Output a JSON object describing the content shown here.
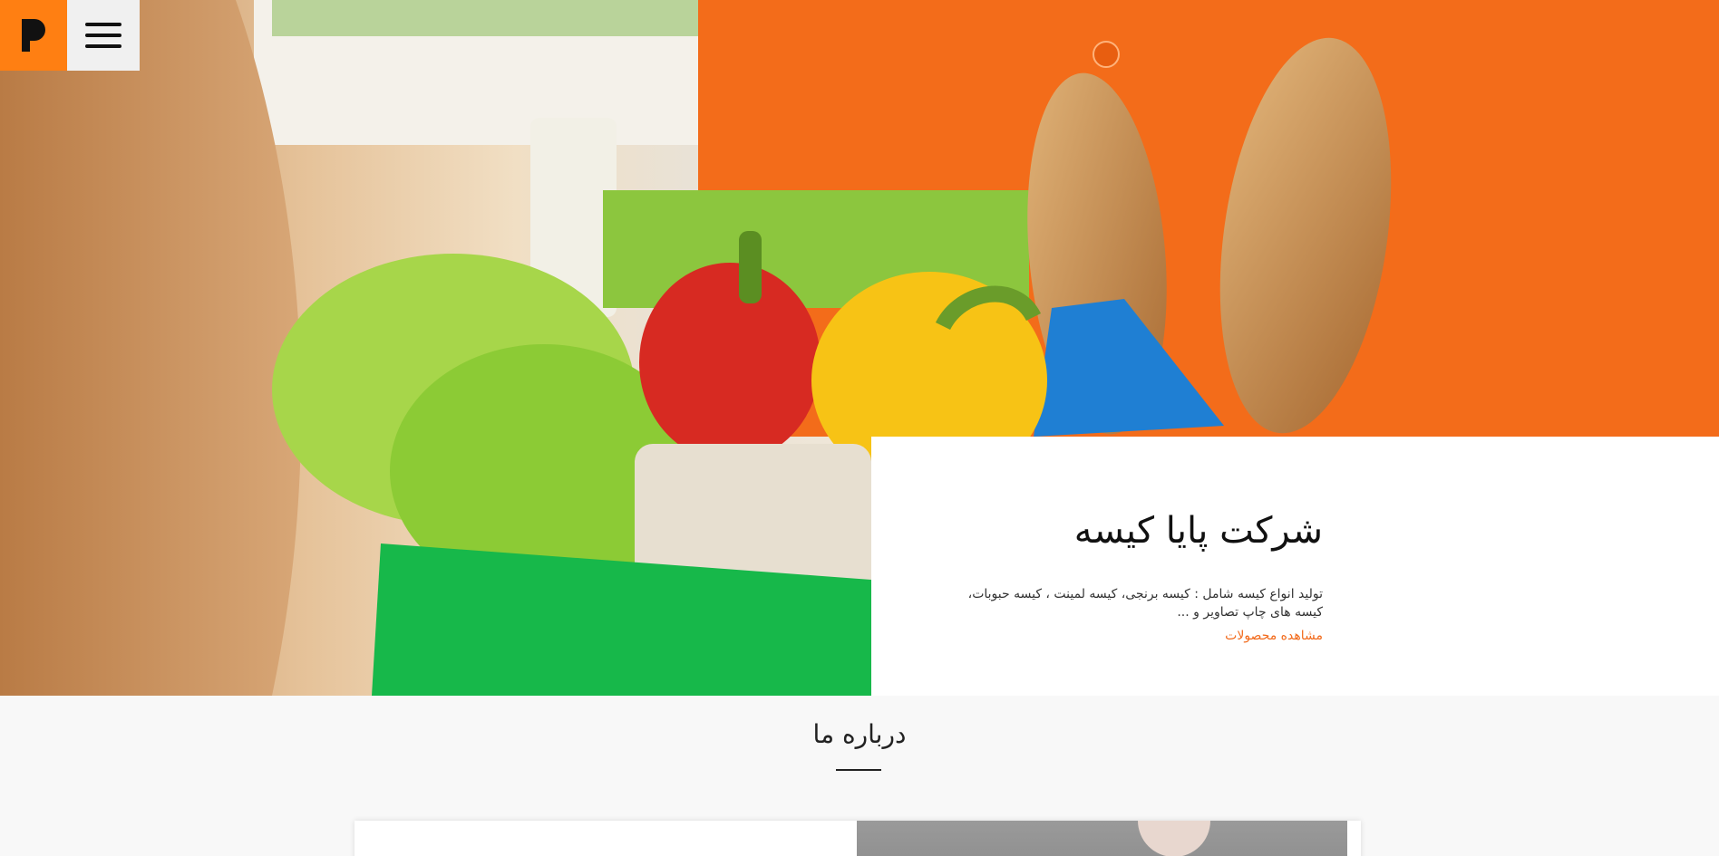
{
  "brand": {
    "logo_letter": "P",
    "logo_color": "#ff7f12"
  },
  "header": {
    "menu_icon": "hamburger-icon"
  },
  "hero": {
    "title": "شرکت پایا کیسه",
    "description": "تولید انواع کیسه شامل : کیسه برنجی، کیسه لمینت ، کیسه حبوبات، کیسه های چاپ تصاویر و ...",
    "link_label": "مشاهده محصولات",
    "accent_color": "#f26a1b"
  },
  "about": {
    "title": "درباره ما"
  }
}
